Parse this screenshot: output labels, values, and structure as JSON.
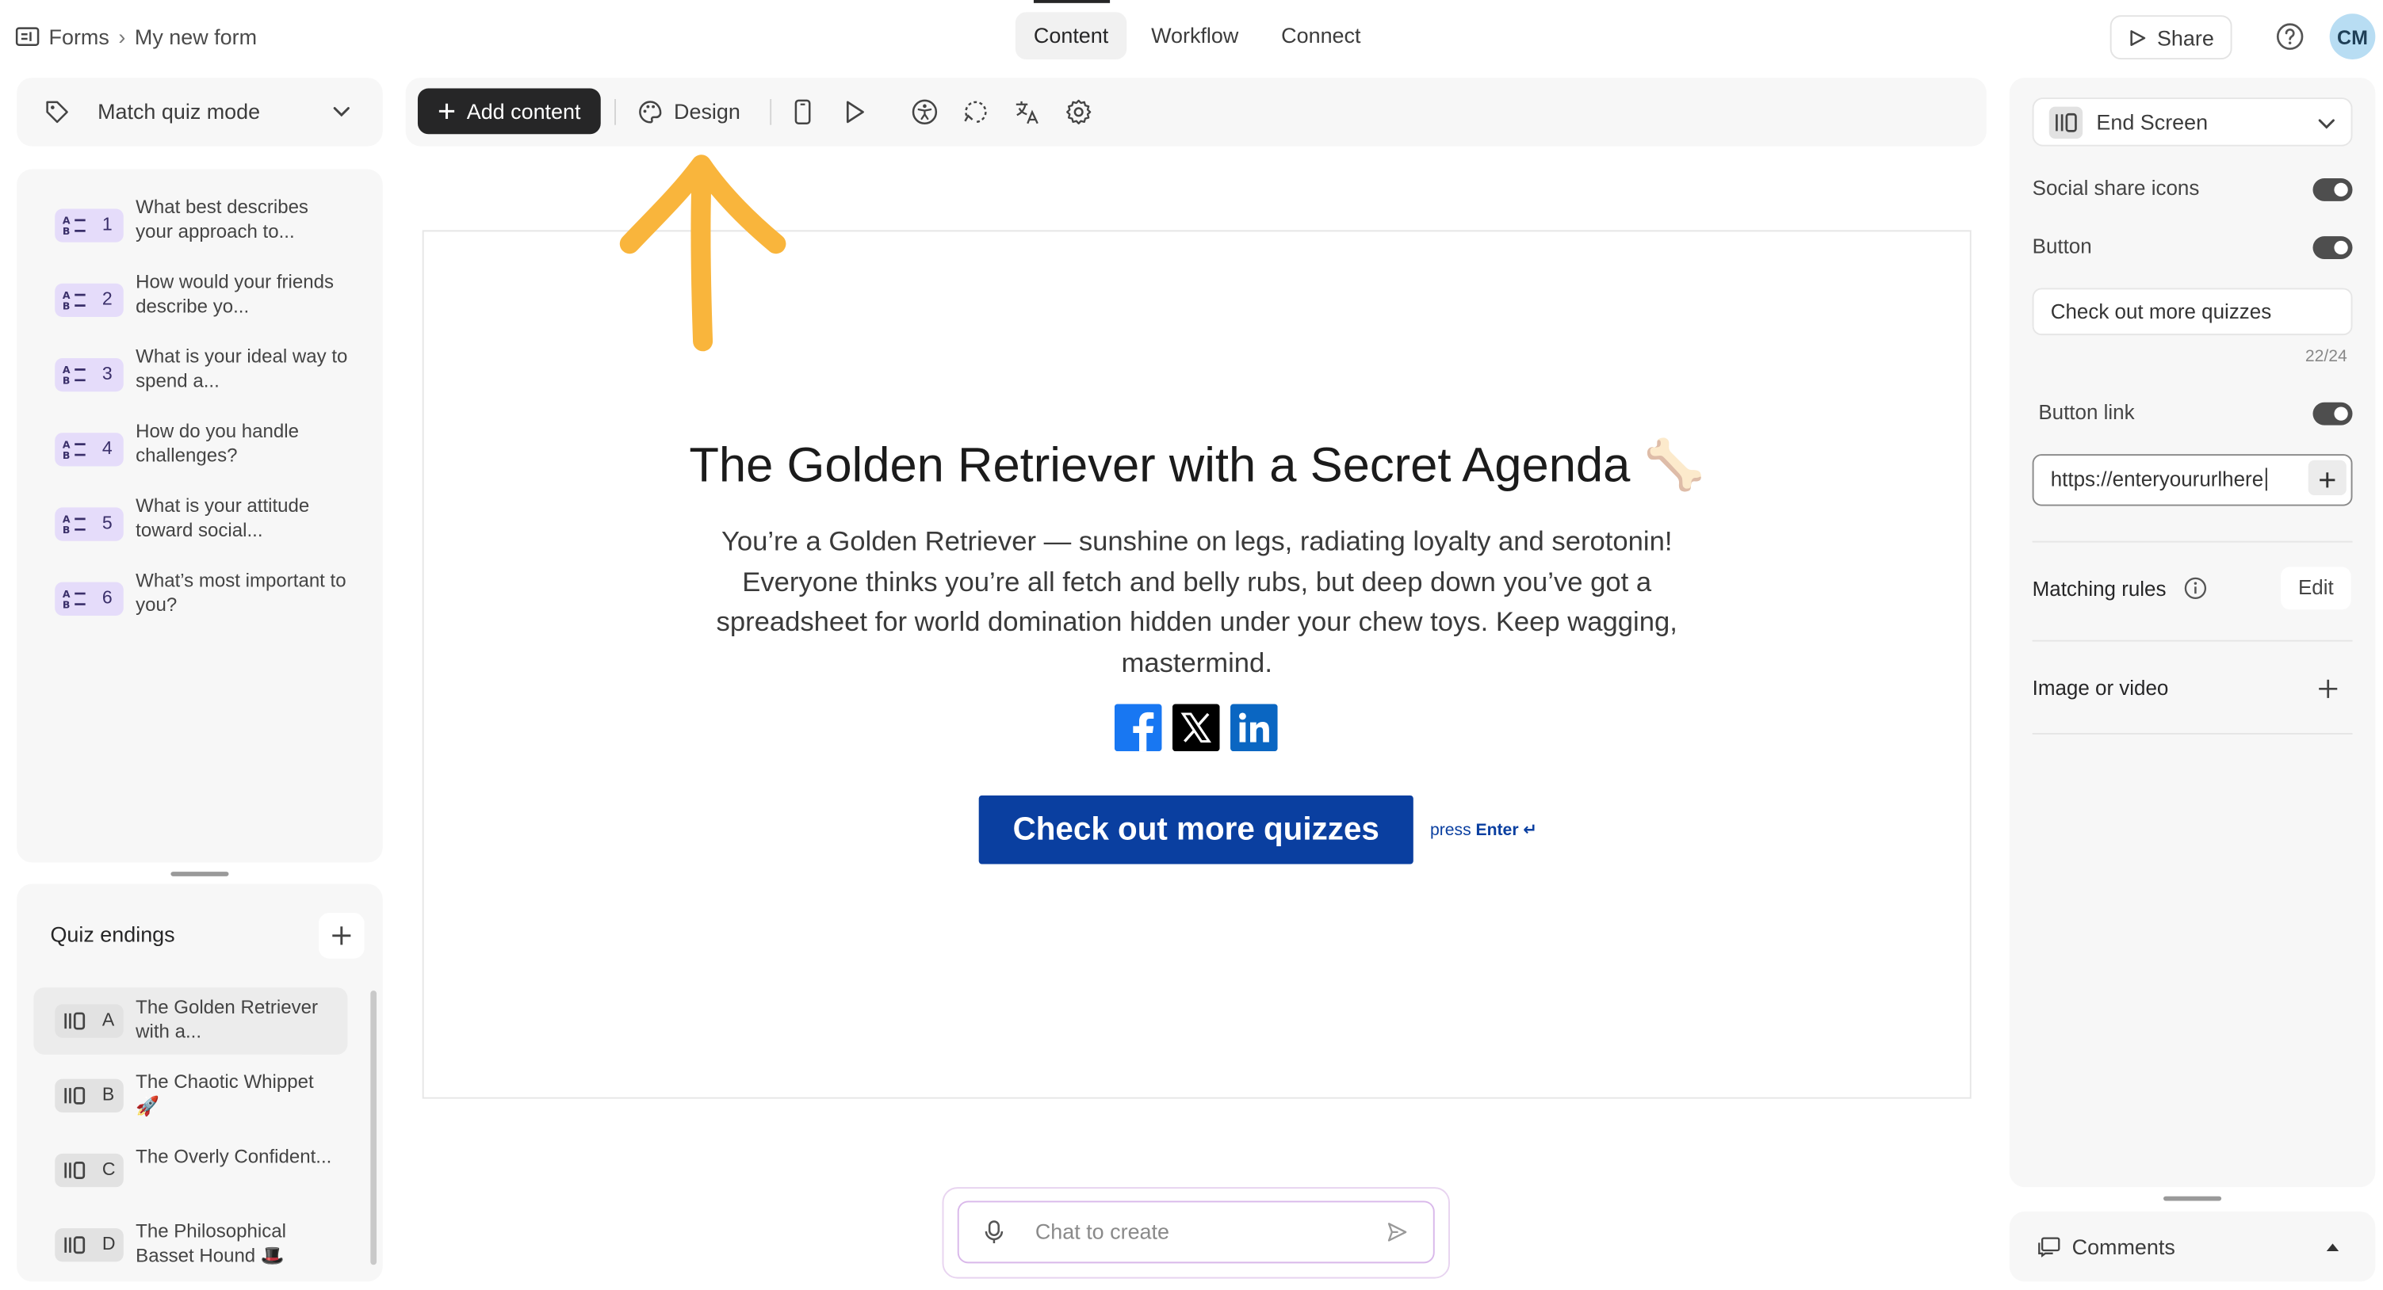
{
  "breadcrumb": {
    "root": "Forms",
    "current": "My new form"
  },
  "tabs": [
    {
      "label": "Content"
    },
    {
      "label": "Workflow"
    },
    {
      "label": "Connect"
    }
  ],
  "header": {
    "share_label": "Share",
    "avatar_initials": "CM"
  },
  "left": {
    "mode_label": "Match quiz mode",
    "questions": [
      {
        "num": "1",
        "text": "What best describes your approach to..."
      },
      {
        "num": "2",
        "text": "How would your friends describe yo..."
      },
      {
        "num": "3",
        "text": "What is your ideal way to spend a..."
      },
      {
        "num": "4",
        "text": "How do you handle challenges?"
      },
      {
        "num": "5",
        "text": "What is your attitude toward social..."
      },
      {
        "num": "6",
        "text": "What’s most important to you?"
      }
    ],
    "endings_title": "Quiz endings",
    "endings": [
      {
        "letter": "A",
        "text": "The Golden Retriever with a..."
      },
      {
        "letter": "B",
        "text": "The Chaotic Whippet 🚀"
      },
      {
        "letter": "C",
        "text": "The Overly Confident..."
      },
      {
        "letter": "D",
        "text": "The Philosophical Basset Hound 🎩"
      }
    ]
  },
  "toolbar": {
    "add_content_label": "Add content",
    "design_label": "Design"
  },
  "canvas": {
    "title": "The Golden Retriever with a Secret Agenda 🦴",
    "description": "You’re a Golden Retriever — sunshine on legs, radiating loyalty and serotonin! Everyone thinks you’re all fetch and belly rubs, but deep down you’ve got a spreadsheet for world domination hidden under your chew toys. Keep wagging, mastermind.",
    "cta_label": "Check out more quizzes",
    "press_label": "press",
    "enter_label": "Enter ↵"
  },
  "chat": {
    "placeholder": "Chat to create"
  },
  "right": {
    "screen_type": "End Screen",
    "social_share_label": "Social share icons",
    "social_share_on": true,
    "button_label": "Button",
    "button_on": true,
    "button_text_value": "Check out more quizzes",
    "char_count": "22/24",
    "button_link_label": "Button link",
    "button_link_on": true,
    "button_link_value": "https://enteryoururlhere",
    "matching_rules_label": "Matching rules",
    "edit_label": "Edit",
    "image_video_label": "Image or video",
    "comments_label": "Comments"
  },
  "colors": {
    "accent_purple": "#e5dcfa",
    "cta_blue": "#0a3fa0",
    "arrow_orange": "#f9b53c",
    "dark_button": "#262627"
  }
}
